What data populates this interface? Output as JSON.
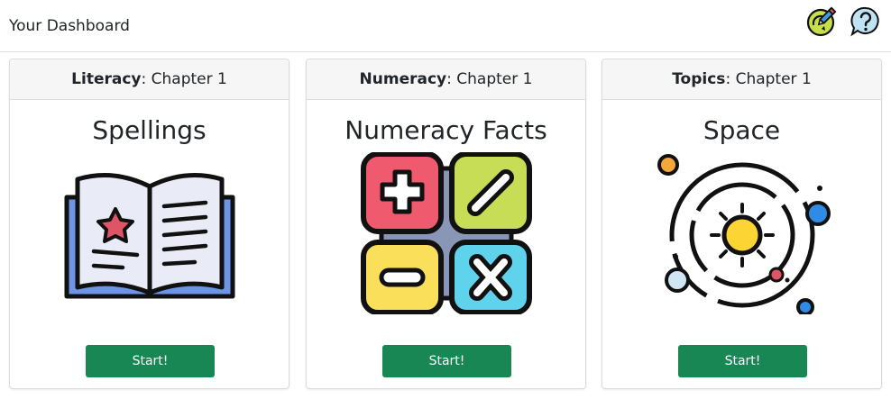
{
  "header": {
    "title": "Your Dashboard",
    "icons": [
      "progress-pencil-icon",
      "help-question-icon"
    ]
  },
  "cards": [
    {
      "subject": "Literacy",
      "separator": ": ",
      "chapter": "Chapter 1",
      "title": "Spellings",
      "illustration": "open-book-star-icon",
      "button_label": "Start!"
    },
    {
      "subject": "Numeracy",
      "separator": ": ",
      "chapter": "Chapter 1",
      "title": "Numeracy Facts",
      "illustration": "math-operators-icon",
      "button_label": "Start!"
    },
    {
      "subject": "Topics",
      "separator": ": ",
      "chapter": "Chapter 1",
      "title": "Space",
      "illustration": "solar-system-icon",
      "button_label": "Start!"
    }
  ],
  "colors": {
    "start_button": "#198754",
    "header_bg": "#f6f6f6"
  }
}
